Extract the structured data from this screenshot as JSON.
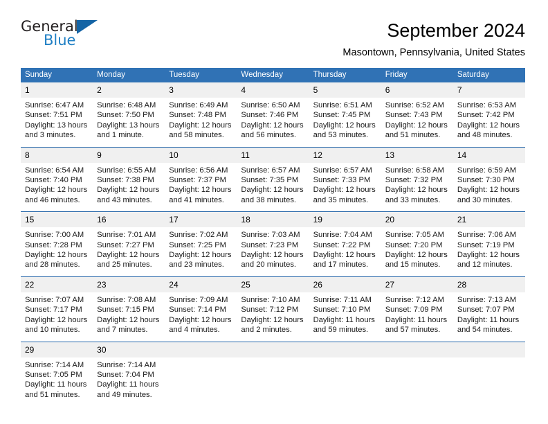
{
  "brand": {
    "name_part1": "General",
    "name_part2": "Blue",
    "triangle_icon": "triangle-icon",
    "colors": {
      "dark": "#231f20",
      "blue": "#1f7fc4",
      "triangle": "#1464a5"
    }
  },
  "header": {
    "title": "September 2024",
    "subtitle": "Masontown, Pennsylvania, United States"
  },
  "theme": {
    "header_bg": "#3072b5",
    "week_separator": "#2364a8",
    "daynum_bg": "#f0f0f0",
    "text": "#000000"
  },
  "calendar": {
    "weekday_headers": [
      "Sunday",
      "Monday",
      "Tuesday",
      "Wednesday",
      "Thursday",
      "Friday",
      "Saturday"
    ],
    "weeks": [
      [
        {
          "day": "1",
          "sunrise": "Sunrise: 6:47 AM",
          "sunset": "Sunset: 7:51 PM",
          "daylight1": "Daylight: 13 hours",
          "daylight2": "and 3 minutes."
        },
        {
          "day": "2",
          "sunrise": "Sunrise: 6:48 AM",
          "sunset": "Sunset: 7:50 PM",
          "daylight1": "Daylight: 13 hours",
          "daylight2": "and 1 minute."
        },
        {
          "day": "3",
          "sunrise": "Sunrise: 6:49 AM",
          "sunset": "Sunset: 7:48 PM",
          "daylight1": "Daylight: 12 hours",
          "daylight2": "and 58 minutes."
        },
        {
          "day": "4",
          "sunrise": "Sunrise: 6:50 AM",
          "sunset": "Sunset: 7:46 PM",
          "daylight1": "Daylight: 12 hours",
          "daylight2": "and 56 minutes."
        },
        {
          "day": "5",
          "sunrise": "Sunrise: 6:51 AM",
          "sunset": "Sunset: 7:45 PM",
          "daylight1": "Daylight: 12 hours",
          "daylight2": "and 53 minutes."
        },
        {
          "day": "6",
          "sunrise": "Sunrise: 6:52 AM",
          "sunset": "Sunset: 7:43 PM",
          "daylight1": "Daylight: 12 hours",
          "daylight2": "and 51 minutes."
        },
        {
          "day": "7",
          "sunrise": "Sunrise: 6:53 AM",
          "sunset": "Sunset: 7:42 PM",
          "daylight1": "Daylight: 12 hours",
          "daylight2": "and 48 minutes."
        }
      ],
      [
        {
          "day": "8",
          "sunrise": "Sunrise: 6:54 AM",
          "sunset": "Sunset: 7:40 PM",
          "daylight1": "Daylight: 12 hours",
          "daylight2": "and 46 minutes."
        },
        {
          "day": "9",
          "sunrise": "Sunrise: 6:55 AM",
          "sunset": "Sunset: 7:38 PM",
          "daylight1": "Daylight: 12 hours",
          "daylight2": "and 43 minutes."
        },
        {
          "day": "10",
          "sunrise": "Sunrise: 6:56 AM",
          "sunset": "Sunset: 7:37 PM",
          "daylight1": "Daylight: 12 hours",
          "daylight2": "and 41 minutes."
        },
        {
          "day": "11",
          "sunrise": "Sunrise: 6:57 AM",
          "sunset": "Sunset: 7:35 PM",
          "daylight1": "Daylight: 12 hours",
          "daylight2": "and 38 minutes."
        },
        {
          "day": "12",
          "sunrise": "Sunrise: 6:57 AM",
          "sunset": "Sunset: 7:33 PM",
          "daylight1": "Daylight: 12 hours",
          "daylight2": "and 35 minutes."
        },
        {
          "day": "13",
          "sunrise": "Sunrise: 6:58 AM",
          "sunset": "Sunset: 7:32 PM",
          "daylight1": "Daylight: 12 hours",
          "daylight2": "and 33 minutes."
        },
        {
          "day": "14",
          "sunrise": "Sunrise: 6:59 AM",
          "sunset": "Sunset: 7:30 PM",
          "daylight1": "Daylight: 12 hours",
          "daylight2": "and 30 minutes."
        }
      ],
      [
        {
          "day": "15",
          "sunrise": "Sunrise: 7:00 AM",
          "sunset": "Sunset: 7:28 PM",
          "daylight1": "Daylight: 12 hours",
          "daylight2": "and 28 minutes."
        },
        {
          "day": "16",
          "sunrise": "Sunrise: 7:01 AM",
          "sunset": "Sunset: 7:27 PM",
          "daylight1": "Daylight: 12 hours",
          "daylight2": "and 25 minutes."
        },
        {
          "day": "17",
          "sunrise": "Sunrise: 7:02 AM",
          "sunset": "Sunset: 7:25 PM",
          "daylight1": "Daylight: 12 hours",
          "daylight2": "and 23 minutes."
        },
        {
          "day": "18",
          "sunrise": "Sunrise: 7:03 AM",
          "sunset": "Sunset: 7:23 PM",
          "daylight1": "Daylight: 12 hours",
          "daylight2": "and 20 minutes."
        },
        {
          "day": "19",
          "sunrise": "Sunrise: 7:04 AM",
          "sunset": "Sunset: 7:22 PM",
          "daylight1": "Daylight: 12 hours",
          "daylight2": "and 17 minutes."
        },
        {
          "day": "20",
          "sunrise": "Sunrise: 7:05 AM",
          "sunset": "Sunset: 7:20 PM",
          "daylight1": "Daylight: 12 hours",
          "daylight2": "and 15 minutes."
        },
        {
          "day": "21",
          "sunrise": "Sunrise: 7:06 AM",
          "sunset": "Sunset: 7:19 PM",
          "daylight1": "Daylight: 12 hours",
          "daylight2": "and 12 minutes."
        }
      ],
      [
        {
          "day": "22",
          "sunrise": "Sunrise: 7:07 AM",
          "sunset": "Sunset: 7:17 PM",
          "daylight1": "Daylight: 12 hours",
          "daylight2": "and 10 minutes."
        },
        {
          "day": "23",
          "sunrise": "Sunrise: 7:08 AM",
          "sunset": "Sunset: 7:15 PM",
          "daylight1": "Daylight: 12 hours",
          "daylight2": "and 7 minutes."
        },
        {
          "day": "24",
          "sunrise": "Sunrise: 7:09 AM",
          "sunset": "Sunset: 7:14 PM",
          "daylight1": "Daylight: 12 hours",
          "daylight2": "and 4 minutes."
        },
        {
          "day": "25",
          "sunrise": "Sunrise: 7:10 AM",
          "sunset": "Sunset: 7:12 PM",
          "daylight1": "Daylight: 12 hours",
          "daylight2": "and 2 minutes."
        },
        {
          "day": "26",
          "sunrise": "Sunrise: 7:11 AM",
          "sunset": "Sunset: 7:10 PM",
          "daylight1": "Daylight: 11 hours",
          "daylight2": "and 59 minutes."
        },
        {
          "day": "27",
          "sunrise": "Sunrise: 7:12 AM",
          "sunset": "Sunset: 7:09 PM",
          "daylight1": "Daylight: 11 hours",
          "daylight2": "and 57 minutes."
        },
        {
          "day": "28",
          "sunrise": "Sunrise: 7:13 AM",
          "sunset": "Sunset: 7:07 PM",
          "daylight1": "Daylight: 11 hours",
          "daylight2": "and 54 minutes."
        }
      ],
      [
        {
          "day": "29",
          "sunrise": "Sunrise: 7:14 AM",
          "sunset": "Sunset: 7:05 PM",
          "daylight1": "Daylight: 11 hours",
          "daylight2": "and 51 minutes."
        },
        {
          "day": "30",
          "sunrise": "Sunrise: 7:14 AM",
          "sunset": "Sunset: 7:04 PM",
          "daylight1": "Daylight: 11 hours",
          "daylight2": "and 49 minutes."
        },
        {
          "day": "",
          "sunrise": "",
          "sunset": "",
          "daylight1": "",
          "daylight2": ""
        },
        {
          "day": "",
          "sunrise": "",
          "sunset": "",
          "daylight1": "",
          "daylight2": ""
        },
        {
          "day": "",
          "sunrise": "",
          "sunset": "",
          "daylight1": "",
          "daylight2": ""
        },
        {
          "day": "",
          "sunrise": "",
          "sunset": "",
          "daylight1": "",
          "daylight2": ""
        },
        {
          "day": "",
          "sunrise": "",
          "sunset": "",
          "daylight1": "",
          "daylight2": ""
        }
      ]
    ]
  }
}
